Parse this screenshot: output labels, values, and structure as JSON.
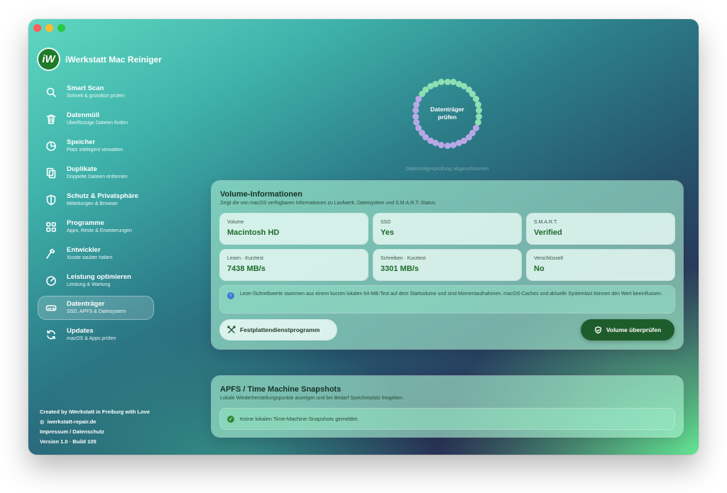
{
  "app": {
    "name": "iWerkstatt Mac Reiniger",
    "logo_text": "iW"
  },
  "sidebar": {
    "items": [
      {
        "title": "Smart Scan",
        "subtitle": "Schnell & gründlich prüfen",
        "icon": "search-icon"
      },
      {
        "title": "Datenmüll",
        "subtitle": "Überflüssige Dateien finden",
        "icon": "trash-icon"
      },
      {
        "title": "Speicher",
        "subtitle": "Platz intelligent verwalten",
        "icon": "pie-chart-icon"
      },
      {
        "title": "Duplikate",
        "subtitle": "Doppelte Dateien entfernen",
        "icon": "duplicate-icon"
      },
      {
        "title": "Schutz & Privatsphäre",
        "subtitle": "Mitteilungen & Browser",
        "icon": "shield-icon"
      },
      {
        "title": "Programme",
        "subtitle": "Apps, Reste & Erweiterungen",
        "icon": "grid-icon"
      },
      {
        "title": "Entwickler",
        "subtitle": "Xcode sauber halten",
        "icon": "hammer-icon"
      },
      {
        "title": "Leistung optimieren",
        "subtitle": "Leistung & Wartung",
        "icon": "gauge-icon"
      },
      {
        "title": "Datenträger",
        "subtitle": "SSD, APFS & Dateisystem",
        "icon": "disk-icon",
        "active": true
      },
      {
        "title": "Updates",
        "subtitle": "macOS & Apps prüfen",
        "icon": "refresh-icon"
      }
    ]
  },
  "footer": {
    "credit": "Created by iWerkstatt in Freiburg with Love",
    "website": "iwerkstatt-repair.de",
    "legal": "Impressum / Datenschutz",
    "version": "Version 1.0 · Build 105"
  },
  "scan": {
    "ring_label_line1": "Datenträger",
    "ring_label_line2": "prüfen",
    "status": "Datenträgerprüfung abgeschlossen"
  },
  "volume": {
    "title": "Volume-Informationen",
    "subtitle": "Zeigt die von macOS verfügbaren Informationen zu Laufwerk, Dateisystem und S.M.A.R.T.-Status.",
    "tiles": [
      {
        "label": "Volume",
        "value": "Macintosh HD"
      },
      {
        "label": "SSD",
        "value": "Yes"
      },
      {
        "label": "S.M.A.R.T.",
        "value": "Verified"
      },
      {
        "label": "Lesen · Kurztest",
        "value": "7438 MB/s"
      },
      {
        "label": "Schreiben · Kurztest",
        "value": "3301 MB/s"
      },
      {
        "label": "Verschlüsselt",
        "value": "No"
      }
    ],
    "info_text": "Lese-/Schreibwerte stammen aus einem kurzen lokalen 64-MB-Test auf dem Startvolume und sind Momentaufnahmen. macOS-Caches und aktuelle Systemlast können den Wert beeinflussen.",
    "utility_button": "Festplattendienstprogramm",
    "primary_button": "Volume überprüfen"
  },
  "snapshots": {
    "title": "APFS / Time Machine Snapshots",
    "subtitle": "Lokale Wiederherstellungspunkte anzeigen und bei Bedarf Speicherplatz freigeben.",
    "message": "Keine lokalen Time-Machine-Snapshots gemeldet."
  },
  "colors": {
    "accent": "#1f5c2c",
    "value_green": "#1e6a2b",
    "ring_green": "#8ee0b4",
    "ring_purple": "#b9a8e6"
  }
}
